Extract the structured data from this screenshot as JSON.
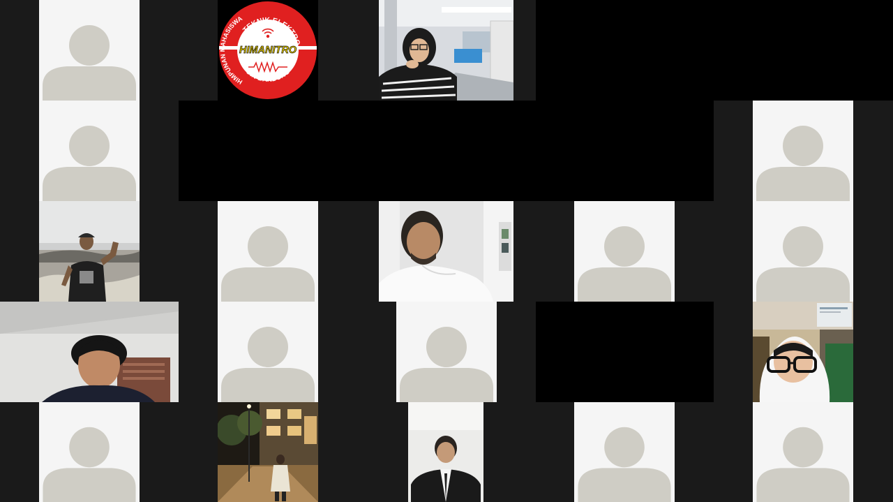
{
  "app": {
    "type": "video-conference-gallery"
  },
  "colors": {
    "background": "#1a1a1a",
    "placeholder_tile": "#f5f5f5",
    "avatar_silhouette": "#cfcdc5",
    "logo_red": "#e02020",
    "logo_yellow": "#f5d800"
  },
  "participants": [
    {
      "kind": "avatar",
      "icon": "default-avatar-icon"
    },
    {
      "kind": "logo",
      "logo": "himanitro-logo"
    },
    {
      "kind": "video",
      "scene": "woman-in-hijab-on-train"
    },
    {
      "kind": "avatar",
      "icon": "default-avatar-icon"
    },
    {
      "kind": "avatar",
      "icon": "default-avatar-icon"
    },
    {
      "kind": "video",
      "scene": "man-at-beach-waving"
    },
    {
      "kind": "avatar",
      "icon": "default-avatar-icon"
    },
    {
      "kind": "video",
      "scene": "man-in-white-shirt-looking-up"
    },
    {
      "kind": "avatar",
      "icon": "default-avatar-icon"
    },
    {
      "kind": "avatar",
      "icon": "default-avatar-icon"
    },
    {
      "kind": "video",
      "scene": "young-man-in-room"
    },
    {
      "kind": "avatar",
      "icon": "default-avatar-icon"
    },
    {
      "kind": "avatar",
      "icon": "default-avatar-icon"
    },
    {
      "kind": "video",
      "scene": "woman-with-glasses-in-white-hijab"
    },
    {
      "kind": "avatar",
      "icon": "default-avatar-icon"
    },
    {
      "kind": "video",
      "scene": "woman-on-street-at-night"
    },
    {
      "kind": "video",
      "scene": "man-in-suit"
    },
    {
      "kind": "avatar",
      "icon": "default-avatar-icon"
    },
    {
      "kind": "avatar",
      "icon": "default-avatar-icon"
    }
  ],
  "logo": {
    "top_text": "TEKNIK ELEKTRO",
    "left_text": "HIMPUNAN MAHASISWA",
    "center_text": "HIMANITRO",
    "bottom_text": "UIN BANDUNG"
  }
}
